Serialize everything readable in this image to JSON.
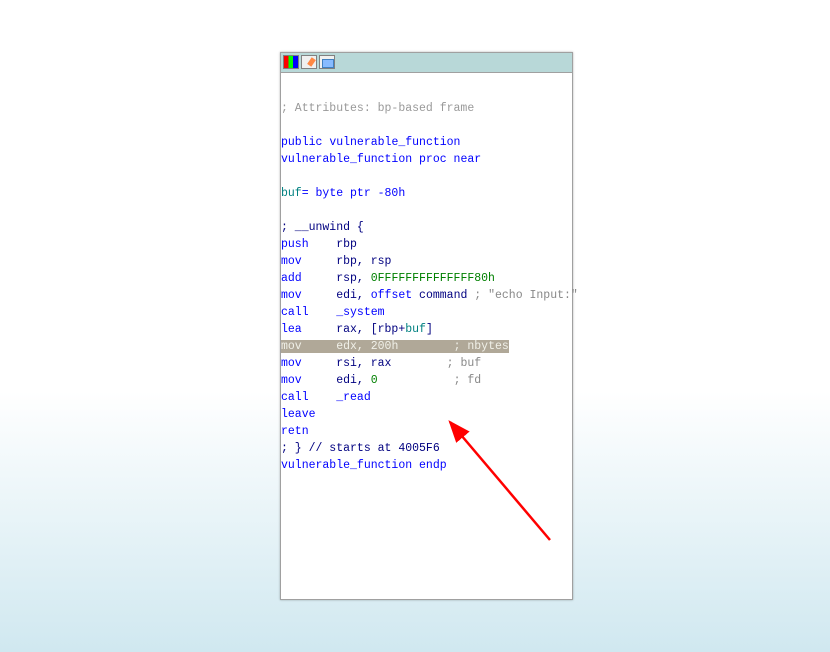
{
  "attributes_comment": "; Attributes: bp-based frame",
  "public_decl": "public",
  "func_name": "vulnerable_function",
  "proc_near": "proc near",
  "buf_label": "buf",
  "buf_def": "= byte ptr -80h",
  "unwind_comment": "; __unwind {",
  "lines": {
    "push": {
      "mn": "push",
      "op": "    rbp"
    },
    "mov1": {
      "mn": "mov",
      "op": "     rbp, rsp"
    },
    "add": {
      "mn": "add",
      "op1": "     rsp, ",
      "op2": "0FFFFFFFFFFFFFF80h"
    },
    "mov2": {
      "mn": "mov",
      "op1": "     edi, ",
      "op2": "offset",
      "op3": " command ",
      "cmt": "; \"echo Input:\""
    },
    "call1": {
      "mn": "call",
      "op": "    _system"
    },
    "lea": {
      "mn": "lea",
      "op1": "     rax, [rbp+",
      "op2": "buf",
      "op3": "]"
    },
    "mov3": {
      "mn": "mov",
      "op1": "     edx, ",
      "op2": "200h",
      "sp": "        ",
      "cmt": "; nbytes"
    },
    "mov4": {
      "mn": "mov",
      "op1": "     rsi, rax        ",
      "cmt": "; buf"
    },
    "mov5": {
      "mn": "mov",
      "op1": "     edi, ",
      "op2": "0",
      "sp": "           ",
      "cmt": "; fd"
    },
    "call2": {
      "mn": "call",
      "op": "    _read"
    },
    "leave": "leave",
    "retn": "retn"
  },
  "end_comment": "; } // starts at 4005F6",
  "endp": "endp"
}
